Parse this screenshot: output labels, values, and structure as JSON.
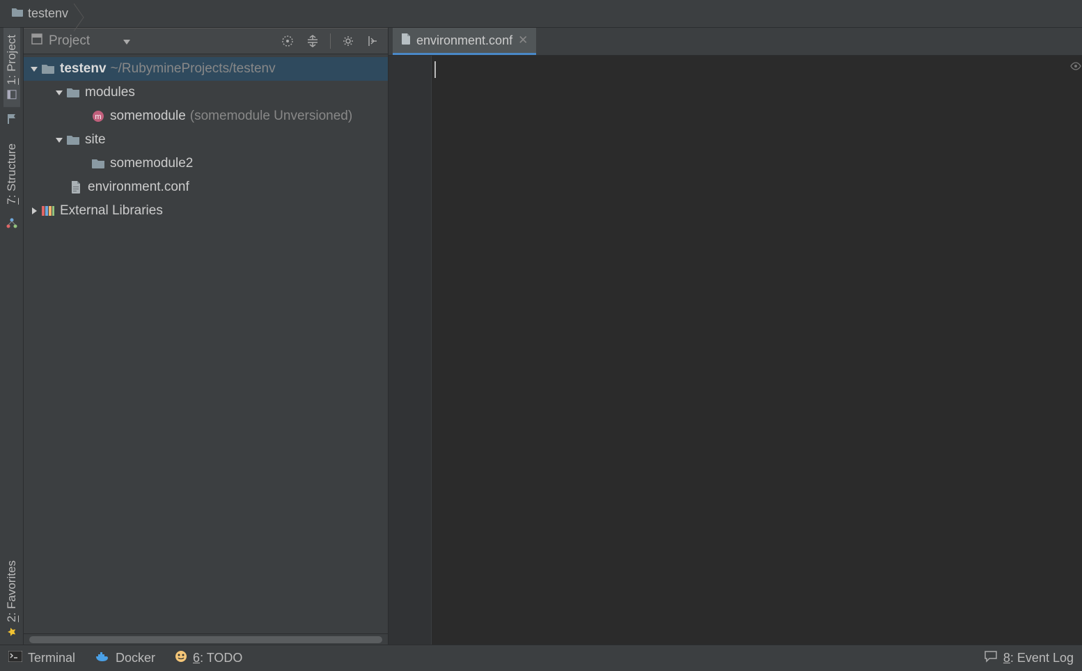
{
  "breadcrumb": {
    "root": "testenv"
  },
  "leftRail": {
    "project": {
      "label": "1: Project",
      "key": "1"
    },
    "structure": {
      "label": "7: Structure",
      "key": "7"
    },
    "favorites": {
      "label": "2: Favorites",
      "key": "2"
    }
  },
  "projectPanel": {
    "title": "Project"
  },
  "tree": {
    "root": {
      "name": "testenv",
      "path": "~/RubymineProjects/testenv"
    },
    "modules": {
      "name": "modules"
    },
    "somemodule": {
      "name": "somemodule",
      "hint": "(somemodule Unversioned)"
    },
    "site": {
      "name": "site"
    },
    "somemodule2": {
      "name": "somemodule2"
    },
    "envfile": {
      "name": "environment.conf"
    },
    "external": {
      "name": "External Libraries"
    }
  },
  "editor": {
    "tab1": {
      "label": "environment.conf"
    }
  },
  "status": {
    "terminal": "Terminal",
    "docker": "Docker",
    "todo": "6: TODO",
    "eventLog": "8: Event Log"
  }
}
